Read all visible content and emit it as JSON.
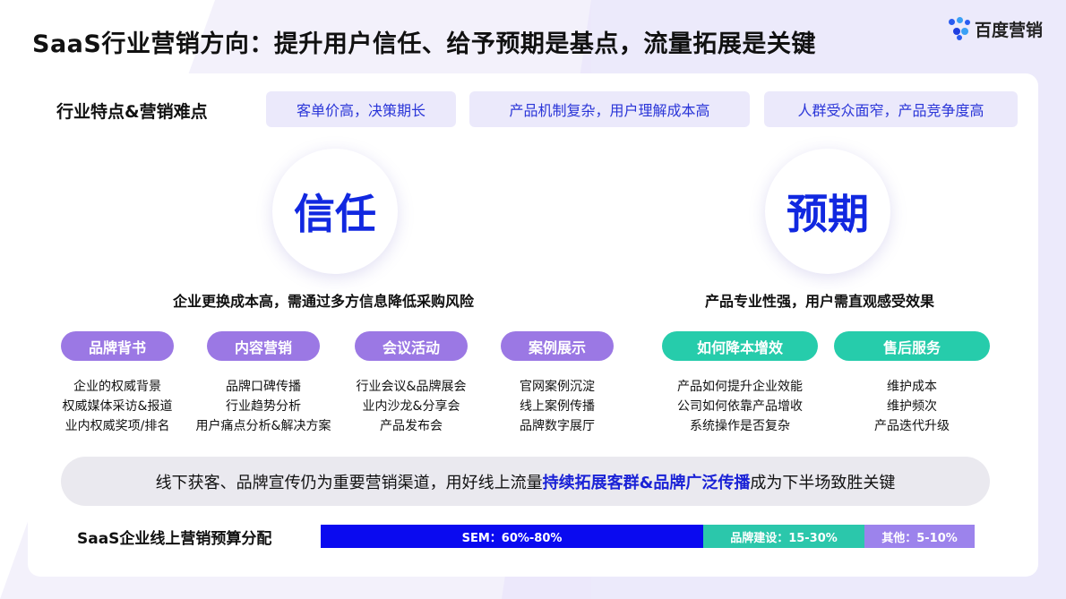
{
  "title": "SaaS行业营销方向：提升用户信任、给予预期是基点，流量拓展是关键",
  "logo": {
    "text": "百度营销",
    "icon": "baidu-marketing-logo-icon"
  },
  "section_title": "行业特点&营销难点",
  "pain_points": [
    "客单价高，决策期长",
    "产品机制复杂，用户理解成本高",
    "人群受众面窄，产品竞争度高"
  ],
  "trust": {
    "label": "信任",
    "subhead": "企业更换成本高，需通过多方信息降低采购风险",
    "categories": [
      {
        "label": "品牌背书",
        "items": [
          "企业的权威背景",
          "权威媒体采访&报道",
          "业内权威奖项/排名"
        ]
      },
      {
        "label": "内容营销",
        "items": [
          "品牌口碑传播",
          "行业趋势分析",
          "用户痛点分析&解决方案"
        ]
      },
      {
        "label": "会议活动",
        "items": [
          "行业会议&品牌展会",
          "业内沙龙&分享会",
          "产品发布会"
        ]
      },
      {
        "label": "案例展示",
        "items": [
          "官网案例沉淀",
          "线上案例传播",
          "品牌数字展厅"
        ]
      }
    ]
  },
  "expectation": {
    "label": "预期",
    "subhead": "产品专业性强，用户需直观感受效果",
    "categories": [
      {
        "label": "如何降本增效",
        "items": [
          "产品如何提升企业效能",
          "公司如何依靠产品增收",
          "系统操作是否复杂"
        ]
      },
      {
        "label": "售后服务",
        "items": [
          "维护成本",
          "维护频次",
          "产品迭代升级"
        ]
      }
    ]
  },
  "banner": {
    "prefix": "线下获客、品牌宣传仍为重要营销渠道，用好线上流量",
    "highlight": "持续拓展客群&品牌广泛传播",
    "suffix": "成为下半场致胜关键"
  },
  "budget": {
    "label": "SaaS企业线上营销预算分配",
    "segments": [
      {
        "label": "SEM：60%-80%",
        "share": 0.585,
        "color": "#0a0af0"
      },
      {
        "label": "品牌建设：15-30%",
        "share": 0.247,
        "color": "#2bc7ab"
      },
      {
        "label": "其他：5-10%",
        "share": 0.168,
        "color": "#9c83ec"
      }
    ]
  },
  "colors": {
    "accent_blue": "#1128e0",
    "pill_violet": "#9b78e4",
    "pill_teal": "#26ccab"
  }
}
